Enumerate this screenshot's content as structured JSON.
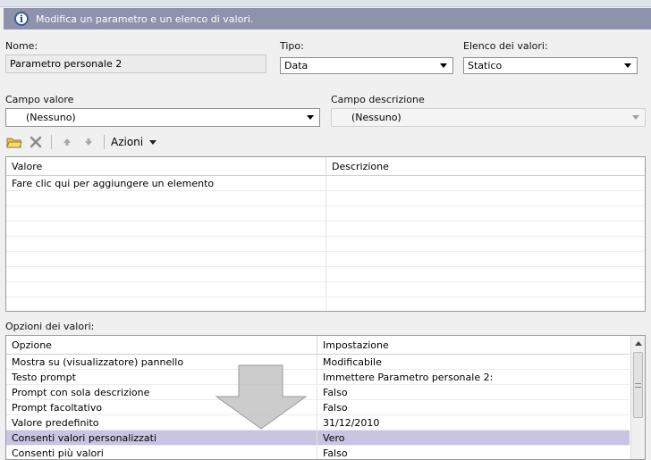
{
  "info": {
    "text": "Modifica un parametro e un elenco di valori."
  },
  "nome": {
    "label": "Nome:",
    "value": "Parametro personale 2"
  },
  "tipo": {
    "label": "Tipo:",
    "value": "Data"
  },
  "elenco": {
    "label": "Elenco dei valori:",
    "value": "Statico"
  },
  "campo_valore": {
    "label": "Campo valore",
    "value": "(Nessuno)"
  },
  "campo_descrizione": {
    "label": "Campo descrizione",
    "value": "(Nessuno)"
  },
  "toolbar": {
    "azioni_label": "Azioni"
  },
  "values_grid": {
    "columns": [
      "Valore",
      "Descrizione"
    ],
    "placeholder_row": "Fare clic qui per aggiungere un elemento"
  },
  "options": {
    "label": "Opzioni dei valori:",
    "columns": [
      "Opzione",
      "Impostazione"
    ],
    "rows": [
      {
        "option": "Mostra su (visualizzatore) pannello",
        "setting": "Modificabile"
      },
      {
        "option": "Testo prompt",
        "setting": "Immettere Parametro personale 2:"
      },
      {
        "option": "Prompt con sola descrizione",
        "setting": "Falso"
      },
      {
        "option": "Prompt facoltativo",
        "setting": "Falso"
      },
      {
        "option": "Valore predefinito",
        "setting": "31/12/2010"
      },
      {
        "option": "Consenti valori personalizzati",
        "setting": "Vero"
      },
      {
        "option": "Consenti più valori",
        "setting": "Falso"
      }
    ]
  },
  "colors": {
    "info_bar": "#8f92ab",
    "selected_row": "#c8c4e2"
  }
}
